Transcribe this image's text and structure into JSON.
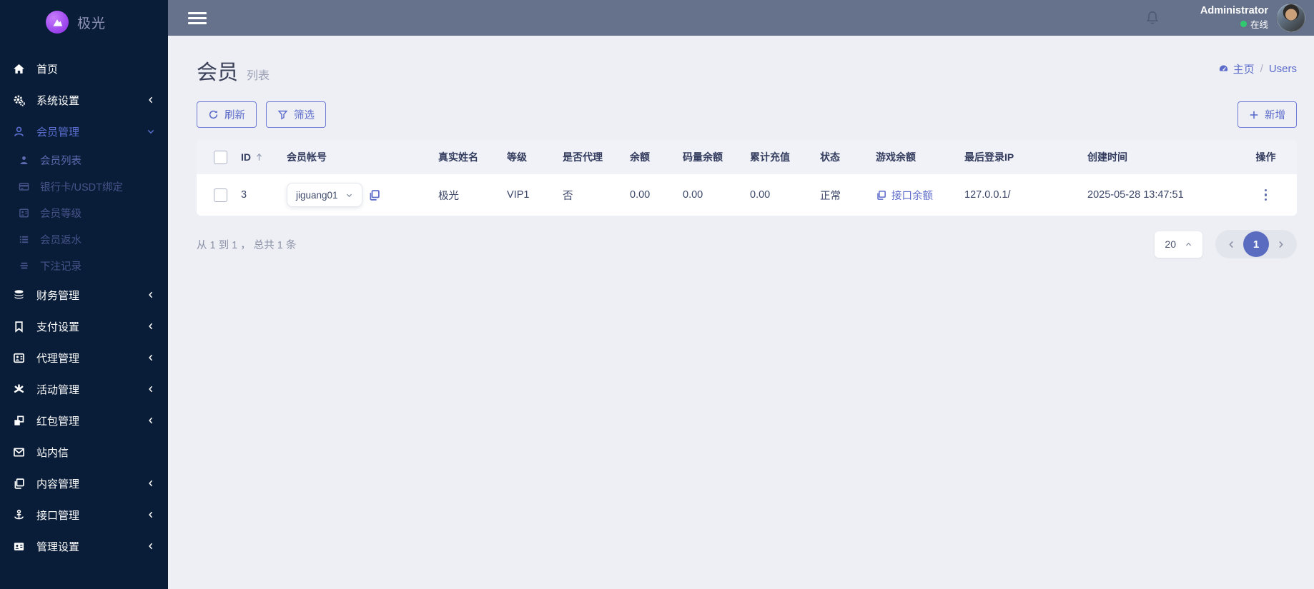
{
  "brand": {
    "name": "极光"
  },
  "topbar": {
    "user_name": "Administrator",
    "user_status": "在线"
  },
  "sidebar": {
    "items": [
      {
        "label": "首页",
        "icon": "home-icon"
      },
      {
        "label": "系统设置",
        "icon": "gears-icon",
        "chevron": "left"
      },
      {
        "label": "会员管理",
        "icon": "member-icon",
        "chevron": "down",
        "active": true,
        "children": [
          {
            "label": "会员列表",
            "icon": "person-icon",
            "active": true
          },
          {
            "label": "银行卡/USDT绑定",
            "icon": "bank-card-icon"
          },
          {
            "label": "会员等级",
            "icon": "member-level-icon"
          },
          {
            "label": "会员返水",
            "icon": "rebate-icon"
          },
          {
            "label": "下注记录",
            "icon": "bet-records-icon"
          }
        ]
      },
      {
        "label": "财务管理",
        "icon": "finance-icon",
        "chevron": "left"
      },
      {
        "label": "支付设置",
        "icon": "payment-icon",
        "chevron": "left"
      },
      {
        "label": "代理管理",
        "icon": "agent-icon",
        "chevron": "left"
      },
      {
        "label": "活动管理",
        "icon": "activity-icon",
        "chevron": "left"
      },
      {
        "label": "红包管理",
        "icon": "redpacket-icon",
        "chevron": "left"
      },
      {
        "label": "站内信",
        "icon": "mail-icon"
      },
      {
        "label": "内容管理",
        "icon": "content-icon",
        "chevron": "left"
      },
      {
        "label": "接口管理",
        "icon": "api-icon",
        "chevron": "left"
      },
      {
        "label": "管理设置",
        "icon": "admin-settings-icon",
        "chevron": "left"
      }
    ]
  },
  "page": {
    "title": "会员",
    "subtitle": "列表",
    "breadcrumb_home": "主页",
    "breadcrumb_sep": "/",
    "breadcrumb_current": "Users"
  },
  "toolbar": {
    "refresh": "刷新",
    "filter": "筛选",
    "add": "新增"
  },
  "table": {
    "headers": {
      "id": "ID",
      "account": "会员帐号",
      "real_name": "真实姓名",
      "level": "等级",
      "is_agent": "是否代理",
      "balance": "余额",
      "code_balance": "码量余额",
      "total_deposit": "累计充值",
      "status": "状态",
      "game_balance": "游戏余额",
      "last_login_ip": "最后登录IP",
      "created_at": "创建时间",
      "actions": "操作"
    },
    "row": {
      "id": "3",
      "account": "jiguang01",
      "real_name": "极光",
      "level": "VIP1",
      "is_agent": "否",
      "balance": "0.00",
      "code_balance": "0.00",
      "total_deposit": "0.00",
      "status": "正常",
      "game_balance_link": "接口余额",
      "last_login_ip": "127.0.0.1/",
      "created_at": "2025-05-28 13:47:51"
    }
  },
  "pagination": {
    "summary": "从 1 到 1 ， 总共 1 条",
    "page_size": "20",
    "current_page": "1"
  },
  "colors": {
    "accent": "#5c6bc9",
    "sidebar_bg": "#0a1d38",
    "topbar_bg": "#66728c",
    "online_green": "#2fca70",
    "page_active": "#5a6cc0"
  }
}
